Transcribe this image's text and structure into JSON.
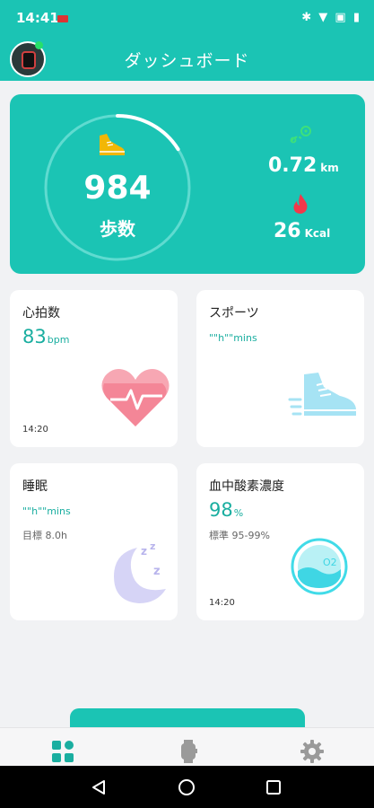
{
  "status_bar": {
    "time": "14:41",
    "icons": "✱ ▼ ▣ ▮"
  },
  "header": {
    "title": "ダッシュボード"
  },
  "steps": {
    "value": "984",
    "label": "歩数",
    "progress": 0.16
  },
  "distance": {
    "value": "0.72",
    "unit": "km"
  },
  "calories": {
    "value": "26",
    "unit": "Kcal"
  },
  "cards": {
    "heart": {
      "title": "心拍数",
      "value": "83",
      "unit": "bpm",
      "time": "14:20",
      "icon": "heart-pulse-icon"
    },
    "sports": {
      "title": "スポーツ",
      "value": "\"\"h\"\"mins",
      "icon": "sneaker-icon"
    },
    "sleep": {
      "title": "睡眠",
      "value": "\"\"h\"\"mins",
      "goal": "目標 8.0h",
      "icon": "moon-zzz-icon"
    },
    "spo2": {
      "title": "血中酸素濃度",
      "value": "98",
      "unit": "%",
      "standard": "標準 95-99%",
      "time": "14:20",
      "icon": "o2-icon",
      "o2": "O2"
    }
  },
  "nav": {
    "items": [
      {
        "name": "dashboard",
        "icon": "grid-icon",
        "active": true
      },
      {
        "name": "device",
        "icon": "watch-icon",
        "active": false
      },
      {
        "name": "settings",
        "icon": "gear-icon",
        "active": false
      }
    ]
  },
  "colors": {
    "accent": "#1bc4b4",
    "value_text": "#1aaea0",
    "heart": "#f36b7f",
    "shoe": "#f2b705"
  }
}
